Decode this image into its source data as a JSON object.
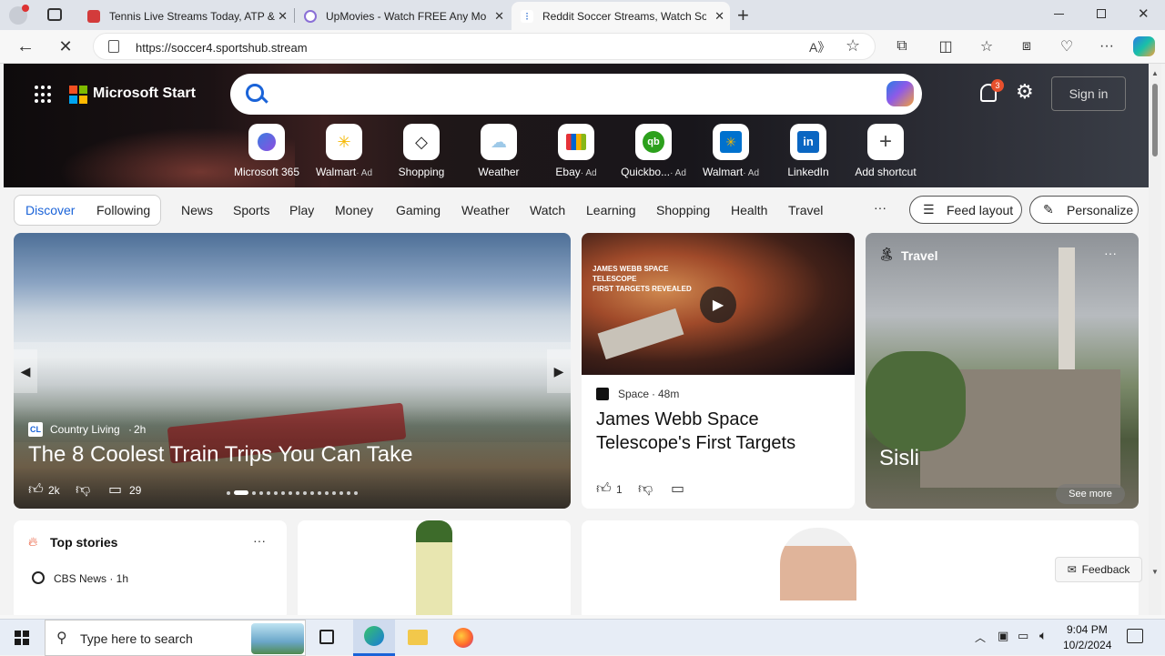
{
  "browser": {
    "tabs": [
      {
        "title": "Tennis Live Streams Today, ATP &",
        "favicon_color": "#d33b3b",
        "active": false
      },
      {
        "title": "UpMovies - Watch FREE Any Mo",
        "favicon_color": "#8a6fd6",
        "active": false
      },
      {
        "title": "Reddit Soccer Streams, Watch So",
        "favicon_color": "#2266cc",
        "active": true
      }
    ],
    "url": "https://soccer4.sportshub.stream"
  },
  "header": {
    "brand": "Microsoft Start",
    "notification_count": "3",
    "signin_label": "Sign in"
  },
  "shortcuts": [
    {
      "label": "Microsoft 365",
      "ad": "",
      "icon": "m365-icon",
      "color": "#6b5bd6"
    },
    {
      "label": "Walmart",
      "ad": "· Ad",
      "icon": "walmart-icon",
      "color": "#f5b800"
    },
    {
      "label": "Shopping",
      "ad": "",
      "icon": "tag-icon",
      "color": "#222222"
    },
    {
      "label": "Weather",
      "ad": "",
      "icon": "weather-icon",
      "color": "#9ec9e8"
    },
    {
      "label": "Ebay",
      "ad": "· Ad",
      "icon": "ebay-icon",
      "color": "#e53238"
    },
    {
      "label": "Quickbo...",
      "ad": "· Ad",
      "icon": "quickbooks-icon",
      "color": "#2ca01c"
    },
    {
      "label": "Walmart",
      "ad": "· Ad",
      "icon": "walmart-icon",
      "color": "#0071ce"
    },
    {
      "label": "LinkedIn",
      "ad": "",
      "icon": "linkedin-icon",
      "color": "#0a66c2"
    },
    {
      "label": "Add shortcut",
      "ad": "",
      "icon": "plus-icon",
      "color": "#444444"
    }
  ],
  "nav": {
    "discover": "Discover",
    "following": "Following",
    "items": [
      "News",
      "Sports",
      "Play",
      "Money",
      "Gaming",
      "Weather",
      "Watch",
      "Learning",
      "Shopping",
      "Health",
      "Travel"
    ],
    "more": "···",
    "feed_layout": "Feed layout",
    "personalize": "Personalize"
  },
  "cards": {
    "main": {
      "source": "Country Living",
      "source_badge": "CL",
      "age": "2h",
      "title": "The 8 Coolest Train Trips You Can Take",
      "likes": "2k",
      "comments": "29"
    },
    "space": {
      "overlay": "JAMES WEBB SPACE TELESCOPE\nFIRST TARGETS REVEALED",
      "source": "Space",
      "age": "48m",
      "title": "James Webb Space Telescope's First Targets",
      "likes": "1"
    },
    "travel": {
      "category": "Travel",
      "place": "Sisli",
      "see_more": "See more"
    },
    "top_stories": {
      "title": "Top stories",
      "source": "CBS News · 1h"
    }
  },
  "feedback_label": "Feedback",
  "taskbar": {
    "search_placeholder": "Type here to search",
    "time": "9:04 PM",
    "date": "10/2/2024"
  }
}
